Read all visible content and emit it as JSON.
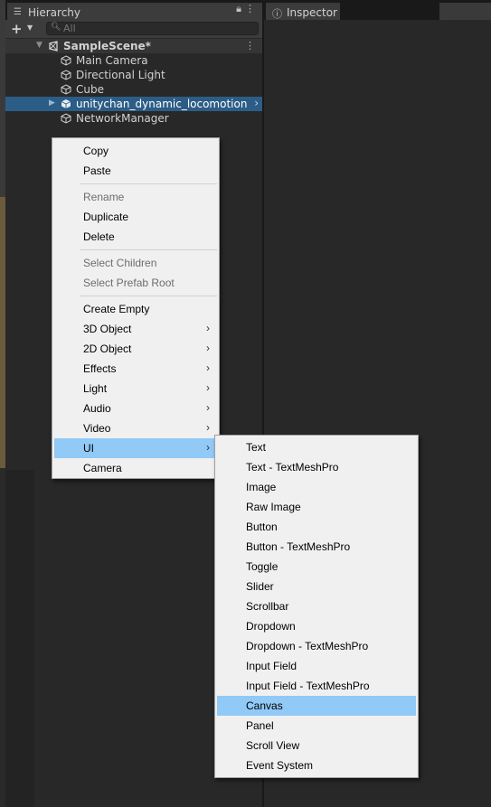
{
  "hierarchy": {
    "tab_label": "Hierarchy",
    "search_placeholder": "All",
    "scene_name": "SampleScene*",
    "items": [
      {
        "label": "Main Camera"
      },
      {
        "label": "Directional Light"
      },
      {
        "label": "Cube"
      },
      {
        "label": "unitychan_dynamic_locomotion",
        "selected": true
      },
      {
        "label": "NetworkManager"
      }
    ]
  },
  "inspector": {
    "tab_label": "Inspector"
  },
  "context_menu": {
    "items": [
      {
        "label": "Copy"
      },
      {
        "label": "Paste"
      },
      {
        "label": "Rename",
        "disabled": true
      },
      {
        "label": "Duplicate"
      },
      {
        "label": "Delete"
      },
      {
        "label": "Select Children",
        "disabled": true
      },
      {
        "label": "Select Prefab Root",
        "disabled": true
      },
      {
        "label": "Create Empty"
      },
      {
        "label": "3D Object",
        "submenu": true
      },
      {
        "label": "2D Object",
        "submenu": true
      },
      {
        "label": "Effects",
        "submenu": true
      },
      {
        "label": "Light",
        "submenu": true
      },
      {
        "label": "Audio",
        "submenu": true
      },
      {
        "label": "Video",
        "submenu": true
      },
      {
        "label": "UI",
        "submenu": true,
        "highlighted": true
      },
      {
        "label": "Camera"
      }
    ]
  },
  "ui_submenu": {
    "items": [
      {
        "label": "Text"
      },
      {
        "label": "Text - TextMeshPro"
      },
      {
        "label": "Image"
      },
      {
        "label": "Raw Image"
      },
      {
        "label": "Button"
      },
      {
        "label": "Button - TextMeshPro"
      },
      {
        "label": "Toggle"
      },
      {
        "label": "Slider"
      },
      {
        "label": "Scrollbar"
      },
      {
        "label": "Dropdown"
      },
      {
        "label": "Dropdown - TextMeshPro"
      },
      {
        "label": "Input Field"
      },
      {
        "label": "Input Field - TextMeshPro"
      },
      {
        "label": "Canvas",
        "highlighted": true
      },
      {
        "label": "Panel"
      },
      {
        "label": "Scroll View"
      },
      {
        "label": "Event System"
      }
    ]
  },
  "colors": {
    "selection": "#2c5d87",
    "menu_highlight": "#91c9f7",
    "menu_bg": "#f0f0f0"
  }
}
